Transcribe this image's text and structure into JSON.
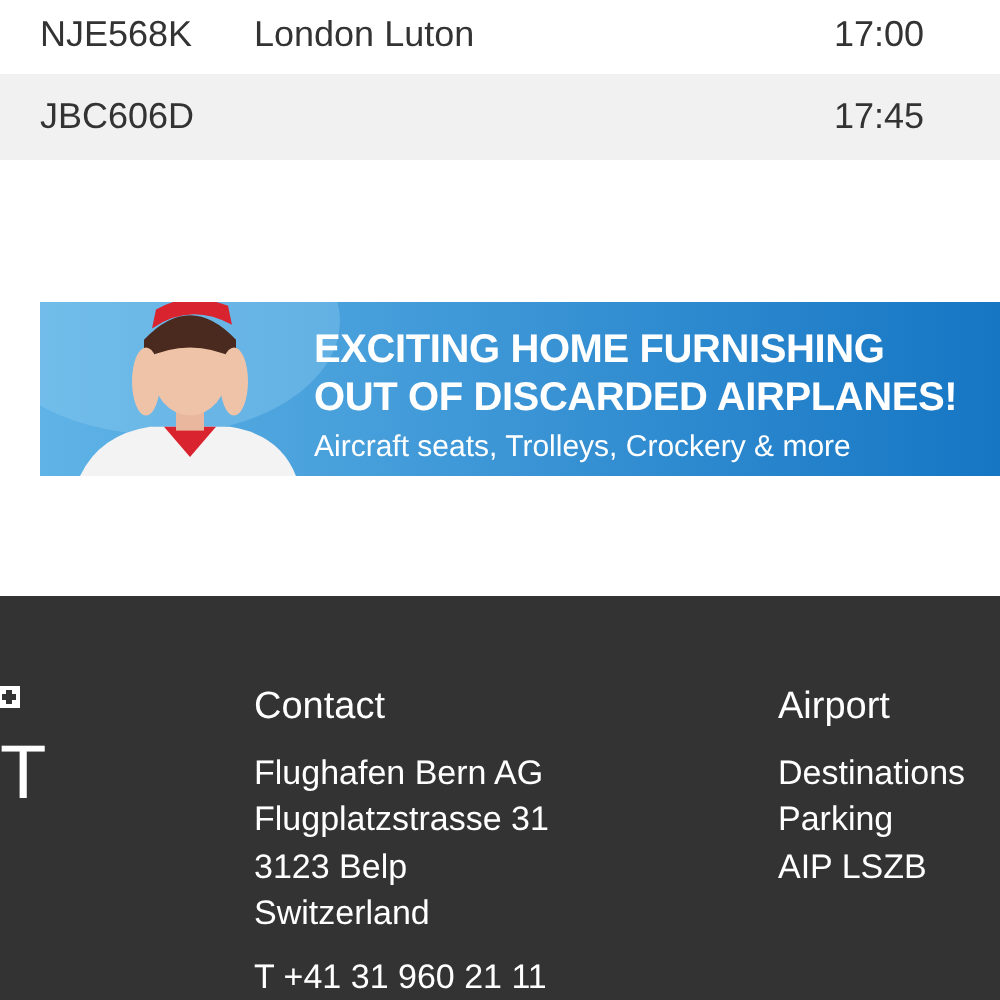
{
  "flights": [
    {
      "flight": "NJE568K",
      "destination": "London Luton",
      "time": "17:00",
      "shaded": false
    },
    {
      "flight": "JBC606D",
      "time": "17:45",
      "shaded": true
    }
  ],
  "banner": {
    "headline": [
      "EXCITING HOME FURNISHING",
      "OUT OF DISCARDED AIRPLANES!"
    ],
    "subline": "Aircraft seats, Trolleys, Crockery & more"
  },
  "footer": {
    "logo_letter": "T",
    "contact": {
      "heading": "Contact",
      "lines": [
        "Flughafen Bern AG",
        "Flugplatzstrasse 31",
        "3123 Belp",
        "Switzerland"
      ],
      "phone": "T +41 31 960 21 11"
    },
    "airport": {
      "heading": "Airport",
      "links": [
        "Destinations",
        "Parking",
        "AIP LSZB"
      ]
    }
  }
}
